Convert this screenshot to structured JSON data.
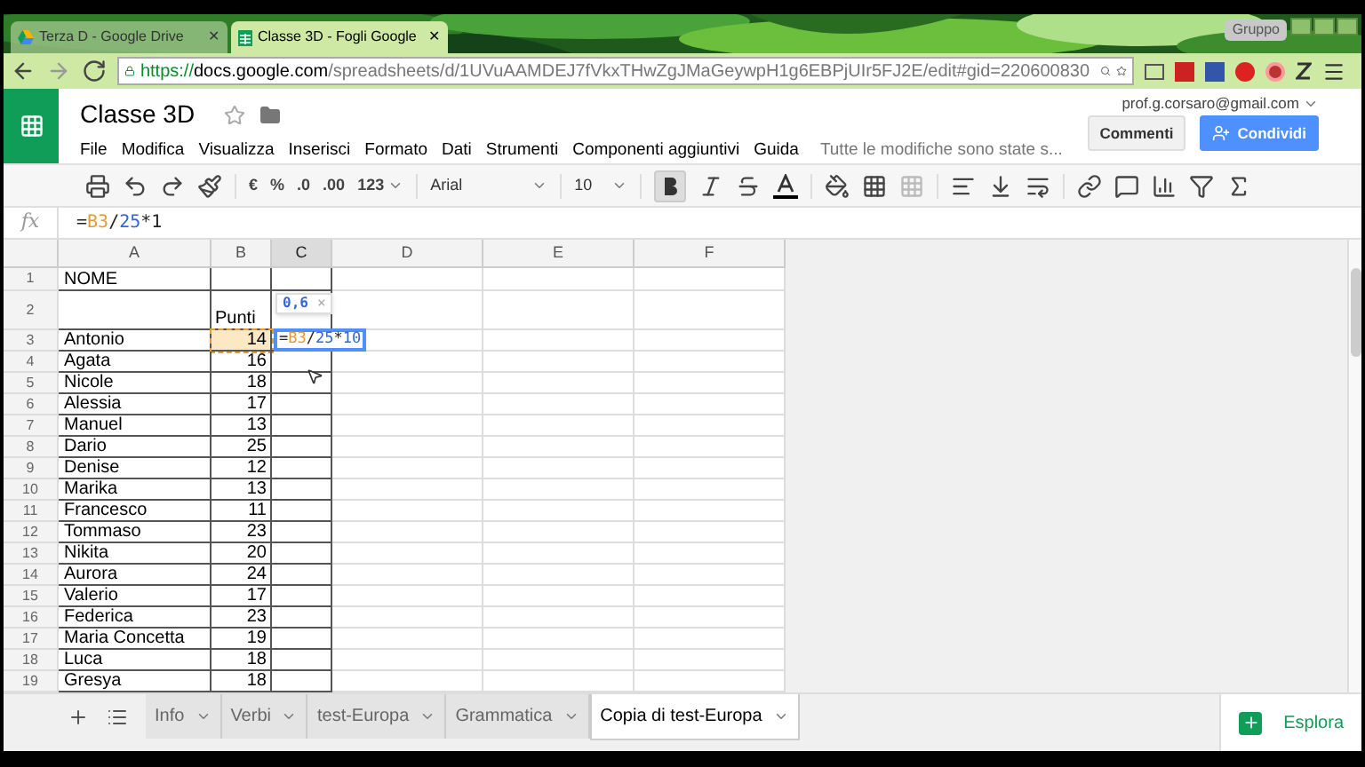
{
  "browser": {
    "tabs": [
      {
        "title": "Terza D - Google Drive",
        "selected": false,
        "kind": "drive",
        "close": "✕"
      },
      {
        "title": "Classe 3D - Fogli Google",
        "selected": true,
        "kind": "sheets",
        "close": "✕"
      }
    ],
    "profile": "Gruppo",
    "url": {
      "scheme": "https://",
      "host": "docs.google.com",
      "path": "/spreadsheets/d/1UVuAAMDEJ7fVkxTHwZgJMaGeywpH1g6EBPjUIr5FJ2E/edit#gid=220600830"
    }
  },
  "doc": {
    "title": "Classe 3D",
    "account": "prof.g.corsaro@gmail.com",
    "menu": [
      "File",
      "Modifica",
      "Visualizza",
      "Inserisci",
      "Formato",
      "Dati",
      "Strumenti",
      "Componenti aggiuntivi",
      "Guida"
    ],
    "save_status": "Tutte le modifiche sono state s...",
    "comments": "Commenti",
    "share": "Condividi"
  },
  "toolbar": {
    "currency": "€",
    "percent": "%",
    "decimals_less": ".0",
    "decimals_more": ".00",
    "more_formats": "123",
    "font": "Arial",
    "size": "10",
    "bold": true
  },
  "formula_bar": {
    "label": "fx",
    "segments": [
      {
        "text": "=",
        "kind": "op"
      },
      {
        "text": "B3",
        "kind": "ref"
      },
      {
        "text": "/",
        "kind": "op"
      },
      {
        "text": "25",
        "kind": "num"
      },
      {
        "text": "*1",
        "kind": "op"
      }
    ]
  },
  "columns": [
    {
      "label": "A",
      "selected": false
    },
    {
      "label": "B",
      "selected": false
    },
    {
      "label": "C",
      "selected": true
    },
    {
      "label": "D",
      "selected": false
    },
    {
      "label": "E",
      "selected": false
    },
    {
      "label": "F",
      "selected": false
    }
  ],
  "rows": [
    {
      "num": "1",
      "a": "NOME",
      "b": ""
    },
    {
      "num": "2",
      "a": "",
      "b": "Punti"
    },
    {
      "num": "3",
      "a": "Antonio",
      "b": "14",
      "selected": true
    },
    {
      "num": "4",
      "a": "Agata",
      "b": "16"
    },
    {
      "num": "5",
      "a": "Nicole",
      "b": "18"
    },
    {
      "num": "6",
      "a": "Alessia",
      "b": "17"
    },
    {
      "num": "7",
      "a": "Manuel",
      "b": "13"
    },
    {
      "num": "8",
      "a": "Dario",
      "b": "25"
    },
    {
      "num": "9",
      "a": "Denise",
      "b": "12"
    },
    {
      "num": "10",
      "a": "Marika",
      "b": "13"
    },
    {
      "num": "11",
      "a": "Francesco",
      "b": "11"
    },
    {
      "num": "12",
      "a": "Tommaso",
      "b": "23"
    },
    {
      "num": "13",
      "a": "Nikita",
      "b": "20"
    },
    {
      "num": "14",
      "a": "Aurora",
      "b": "24"
    },
    {
      "num": "15",
      "a": "Valerio",
      "b": "17"
    },
    {
      "num": "16",
      "a": "Federica",
      "b": "23"
    },
    {
      "num": "17",
      "a": "Maria Concetta",
      "b": "19"
    },
    {
      "num": "18",
      "a": "Luca",
      "b": "18"
    },
    {
      "num": "19",
      "a": "Gresya",
      "b": "18"
    }
  ],
  "editor": {
    "preview": "0,6",
    "close": "×",
    "segments": [
      {
        "text": "=",
        "kind": "op"
      },
      {
        "text": "B3",
        "kind": "ref"
      },
      {
        "text": "/",
        "kind": "op"
      },
      {
        "text": "25",
        "kind": "num"
      },
      {
        "text": "*",
        "kind": "op"
      },
      {
        "text": "10",
        "kind": "num"
      }
    ]
  },
  "sheets": [
    {
      "label": "Info",
      "selected": false
    },
    {
      "label": "Verbi",
      "selected": false
    },
    {
      "label": "test-Europa",
      "selected": false
    },
    {
      "label": "Grammatica",
      "selected": false
    },
    {
      "label": "Copia di test-Europa",
      "selected": true
    }
  ],
  "explore": "Esplora"
}
